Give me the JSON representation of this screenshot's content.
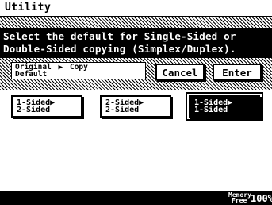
{
  "screen": {
    "title": "Utility"
  },
  "message": {
    "line1": "Select the default for Single-Sided or",
    "line2": "Double-Sided copying (Simplex/Duplex)."
  },
  "breadcrumb": {
    "item1_line1": "Original",
    "item1_line2": "Default",
    "arrow": "▶",
    "item2": "Copy"
  },
  "actions": {
    "cancel_label": "Cancel",
    "enter_label": "Enter"
  },
  "options": [
    {
      "line1": "1-Sided▶",
      "line2": "2-Sided",
      "selected": false
    },
    {
      "line1": "2-Sided▶",
      "line2": "2-Sided",
      "selected": false
    },
    {
      "line1": "1-Sided▶",
      "line2": "1-Sided",
      "selected": true
    }
  ],
  "status": {
    "memory_label_line1": "Memory",
    "memory_label_line2": "Free",
    "memory_value": "100%"
  }
}
